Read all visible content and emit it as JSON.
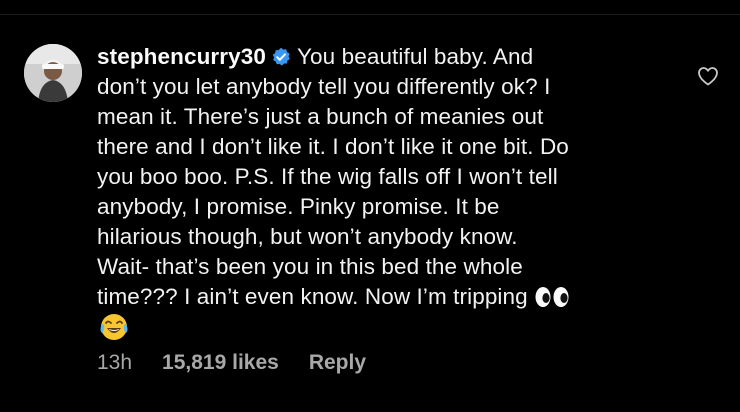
{
  "comment": {
    "username": "stephencurry30",
    "lines": [
      "You beautiful baby. And",
      "don’t you let anybody tell you differently ok? I",
      "mean it. There’s just a bunch of meanies out",
      "there and I don’t like it. I don’t like it one bit. Do",
      "you boo boo. P.S. If the wig falls off I won’t tell",
      "anybody, I promise. Pinky promise. It be",
      "hilarious though, but won’t anybody know.",
      "Wait- that’s been you in this bed the whole",
      "time??? I ain’t even know. Now I’m tripping"
    ],
    "icons": {
      "verified": "verified-badge-icon",
      "eyes": "eyes-emoji-icon",
      "laughing": "tears-of-joy-emoji-icon",
      "like": "heart-icon"
    },
    "colors": {
      "verified": "#3897f0",
      "meta_text": "#a8a8a8",
      "background": "#000000"
    }
  },
  "meta": {
    "time": "13h",
    "likes": "15,819 likes",
    "reply": "Reply"
  }
}
